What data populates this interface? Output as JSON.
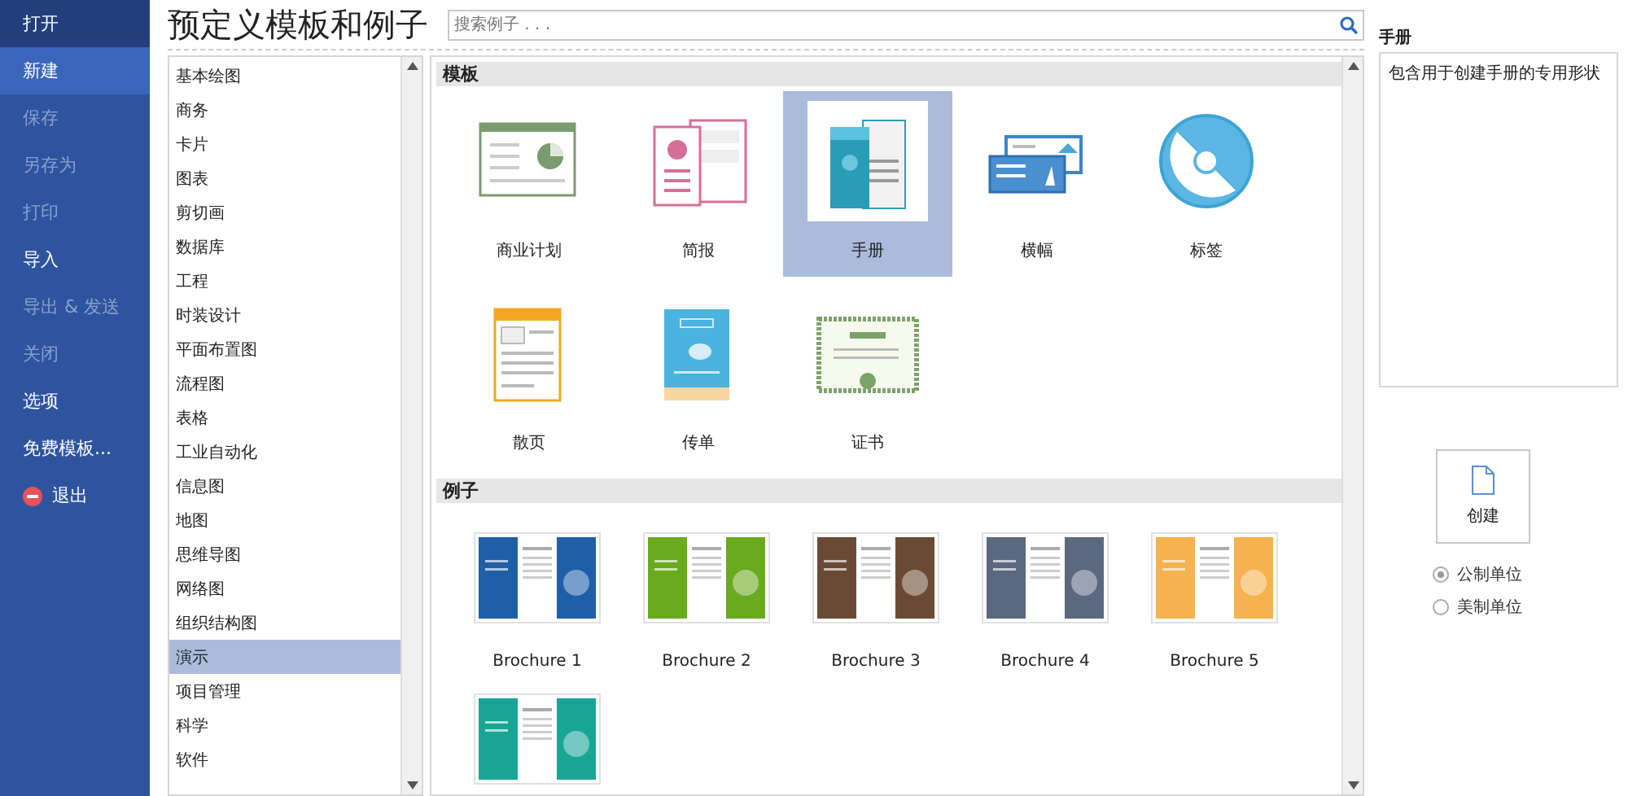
{
  "sidebar": {
    "items": [
      {
        "label": "打开",
        "selected": false,
        "hover": true,
        "disabled": false
      },
      {
        "label": "新建",
        "selected": true,
        "hover": false,
        "disabled": false
      },
      {
        "label": "保存",
        "selected": false,
        "hover": false,
        "disabled": true
      },
      {
        "label": "另存为",
        "selected": false,
        "hover": false,
        "disabled": true
      },
      {
        "label": "打印",
        "selected": false,
        "hover": false,
        "disabled": true
      },
      {
        "label": "导入",
        "selected": false,
        "hover": false,
        "disabled": false
      },
      {
        "label": "导出 & 发送",
        "selected": false,
        "hover": false,
        "disabled": true
      },
      {
        "label": "关闭",
        "selected": false,
        "hover": false,
        "disabled": true
      },
      {
        "label": "选项",
        "selected": false,
        "hover": false,
        "disabled": false
      },
      {
        "label": "免费模板...",
        "selected": false,
        "hover": false,
        "disabled": false
      },
      {
        "label": "退出",
        "selected": false,
        "hover": false,
        "disabled": false,
        "kind": "exit"
      }
    ]
  },
  "title": "预定义模板和例子",
  "search": {
    "placeholder": "搜索例子 . . ."
  },
  "categories": [
    {
      "label": "基本绘图",
      "selected": false
    },
    {
      "label": "商务",
      "selected": false
    },
    {
      "label": "卡片",
      "selected": false
    },
    {
      "label": "图表",
      "selected": false
    },
    {
      "label": "剪切画",
      "selected": false
    },
    {
      "label": "数据库",
      "selected": false
    },
    {
      "label": "工程",
      "selected": false
    },
    {
      "label": "时装设计",
      "selected": false
    },
    {
      "label": "平面布置图",
      "selected": false
    },
    {
      "label": "流程图",
      "selected": false
    },
    {
      "label": "表格",
      "selected": false
    },
    {
      "label": "工业自动化",
      "selected": false
    },
    {
      "label": "信息图",
      "selected": false
    },
    {
      "label": "地图",
      "selected": false
    },
    {
      "label": "思维导图",
      "selected": false
    },
    {
      "label": "网络图",
      "selected": false
    },
    {
      "label": "组织结构图",
      "selected": false
    },
    {
      "label": "演示",
      "selected": true
    },
    {
      "label": "项目管理",
      "selected": false
    },
    {
      "label": "科学",
      "selected": false
    },
    {
      "label": "软件",
      "selected": false
    }
  ],
  "templates": {
    "heading": "模板",
    "items": [
      {
        "label": "商业计划",
        "kind": "slide",
        "selected": false
      },
      {
        "label": "简报",
        "kind": "newsletter",
        "selected": false
      },
      {
        "label": "手册",
        "kind": "brochure",
        "selected": true
      },
      {
        "label": "横幅",
        "kind": "banner",
        "selected": false
      },
      {
        "label": "标签",
        "kind": "disc",
        "selected": false
      },
      {
        "label": "散页",
        "kind": "sheet",
        "selected": false
      },
      {
        "label": "传单",
        "kind": "flyer",
        "selected": false
      },
      {
        "label": "证书",
        "kind": "certificate",
        "selected": false
      }
    ]
  },
  "examples": {
    "heading": "例子",
    "items": [
      {
        "label": "Brochure 1",
        "color": "#1f5fa8"
      },
      {
        "label": "Brochure 2",
        "color": "#6aaa1e"
      },
      {
        "label": "Brochure 3",
        "color": "#6b4a35"
      },
      {
        "label": "Brochure 4",
        "color": "#5b6880"
      },
      {
        "label": "Brochure 5",
        "color": "#f6b24e"
      },
      {
        "color": "#19a596"
      }
    ]
  },
  "details": {
    "title": "手册",
    "description": "包含用于创建手册的专用形状"
  },
  "create_button": "创建",
  "units": [
    {
      "label": "公制单位",
      "selected": true
    },
    {
      "label": "美制单位",
      "selected": false
    }
  ]
}
